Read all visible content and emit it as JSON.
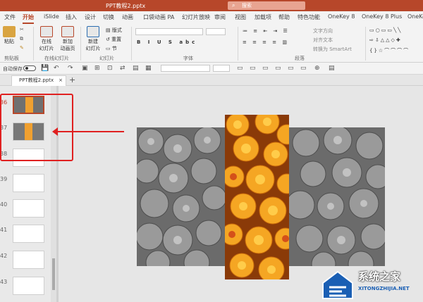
{
  "title_bar": {
    "doc_name": "PPT教程2.pptx",
    "search_placeholder": "搜索"
  },
  "tabs": [
    "文件",
    "开始",
    "iSlide",
    "插入",
    "设计",
    "切换",
    "动画",
    "口袋动画 PA",
    "幻灯片放映",
    "审阅",
    "视图",
    "加载项",
    "帮助",
    "特色功能",
    "OneKey 8",
    "OneKey 8 Plus",
    "OneKe"
  ],
  "active_tab": "开始",
  "ribbon": {
    "paste": "粘贴",
    "clipboard_group": "剪贴板",
    "online_slides_a": "在线",
    "online_slides_b": "幻灯片",
    "new_anim_a": "新加",
    "new_anim_b": "动画页",
    "online_group": "在线幻灯片",
    "new_slide_a": "新建",
    "new_slide_b": "幻灯片",
    "layout": "版式",
    "reset": "重置",
    "section": "节",
    "slides_group": "幻灯片",
    "font_group": "字体",
    "text_dir": "文字方向",
    "align_text": "对齐文本",
    "smartart": "转换为 SmartArt",
    "paragraph_group": "段落"
  },
  "qat": {
    "autosave": "自动保存",
    "toggle_state": "关"
  },
  "doc_tab": {
    "name": "PPT教程2.pptx"
  },
  "thumbnails": [
    {
      "num": "36",
      "selected": true
    },
    {
      "num": "37",
      "selected": false
    },
    {
      "num": "38",
      "selected": false
    },
    {
      "num": "39",
      "selected": false
    },
    {
      "num": "40",
      "selected": false
    },
    {
      "num": "41",
      "selected": false
    },
    {
      "num": "42",
      "selected": false
    },
    {
      "num": "43",
      "selected": false
    }
  ],
  "watermark": {
    "title": "系统之家",
    "url": "XITONGZHIJIA.NET"
  },
  "colors": {
    "accent": "#b7472a",
    "annotation": "#e02020",
    "flower_orange": "#f5a623",
    "flower_gray": "#8c8c8c"
  }
}
